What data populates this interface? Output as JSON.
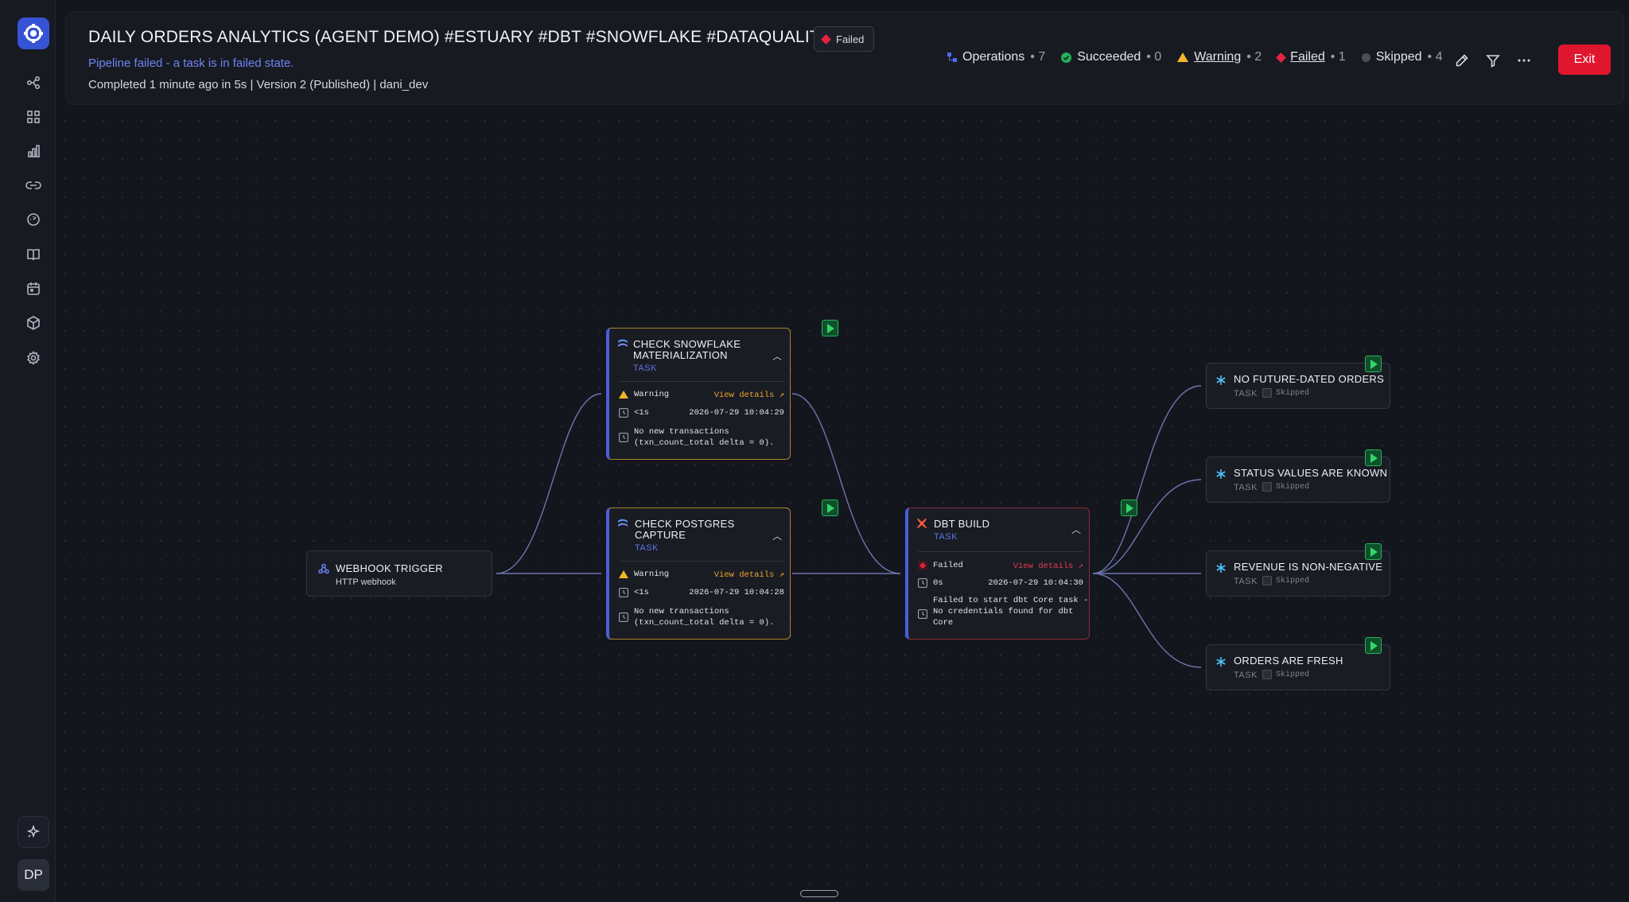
{
  "header": {
    "title": "DAILY ORDERS ANALYTICS (AGENT DEMO) #ESTUARY #DBT #SNOWFLAKE #DATAQUALITY",
    "status": "Failed",
    "subtitle": "Pipeline failed - a task is in failed state.",
    "meta": "Completed 1 minute ago in 5s | Version 2 (Published)  |  dani_dev",
    "counts": {
      "operations": {
        "label": "Operations",
        "value": "• 7"
      },
      "succeeded": {
        "label": "Succeeded",
        "value": "• 0"
      },
      "warning": {
        "label": "Warning",
        "value": "• 2"
      },
      "failed": {
        "label": "Failed",
        "value": "• 1"
      },
      "skipped": {
        "label": "Skipped",
        "value": "• 4"
      }
    },
    "exit_label": "Exit"
  },
  "sidebar": {
    "avatar": "DP"
  },
  "colors": {
    "accent": "#3653d6",
    "failed": "#e0162e",
    "warning": "#f2b628",
    "success": "#27b45a"
  },
  "nodes": {
    "webhook": {
      "title": "WEBHOOK TRIGGER",
      "subtitle": "HTTP webhook"
    },
    "snowflake": {
      "title_1": "CHECK SNOWFLAKE",
      "title_2": "MATERIALIZATION",
      "type": "TASK",
      "status": "Warning",
      "link": "View details ↗",
      "duration": "<1s",
      "timestamp": "2026-07-29 10:04:29",
      "msg_1": "No new transactions",
      "msg_2": "(txn_count_total delta = 0)."
    },
    "postgres": {
      "title_1": "CHECK POSTGRES",
      "title_2": "CAPTURE",
      "type": "TASK",
      "status": "Warning",
      "link": "View details ↗",
      "duration": "<1s",
      "timestamp": "2026-07-29 10:04:28",
      "msg_1": "No new transactions",
      "msg_2": "(txn_count_total delta = 0)."
    },
    "dbt": {
      "title": "DBT BUILD",
      "type": "TASK",
      "status": "Failed",
      "link": "View details ↗",
      "duration": "0s",
      "timestamp": "2026-07-29 10:04:30",
      "msg_1": "Failed to start dbt Core task -",
      "msg_2": "No credentials found for dbt",
      "msg_3": "Core"
    },
    "checks": [
      {
        "title": "NO FUTURE-DATED ORDERS",
        "type": "TASK",
        "status": "Skipped"
      },
      {
        "title": "STATUS VALUES ARE KNOWN",
        "type": "TASK",
        "status": "Skipped"
      },
      {
        "title": "REVENUE IS NON-NEGATIVE",
        "type": "TASK",
        "status": "Skipped"
      },
      {
        "title": "ORDERS ARE FRESH",
        "type": "TASK",
        "status": "Skipped"
      }
    ]
  }
}
